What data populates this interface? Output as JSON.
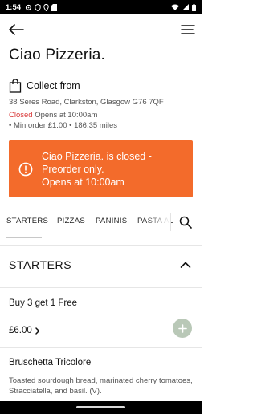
{
  "status_bar": {
    "time": "1:54",
    "icons": [
      "gear-icon",
      "shield-icon",
      "location-pin-icon",
      "sd-card-icon",
      "wifi-icon",
      "signal-icon",
      "battery-icon"
    ]
  },
  "header": {
    "back_icon": "arrow-left-icon",
    "menu_icon": "hamburger-menu-icon"
  },
  "restaurant": {
    "name": "Ciao Pizzeria.",
    "collect_label": "Collect from",
    "address": "38 Seres Road, Clarkston, Glasgow G76 7QF",
    "status_closed": "Closed",
    "opens_text": " Opens at 10:00am",
    "min_order": "• Min order £1.00 • 186.35  miles"
  },
  "banner": {
    "lines": [
      "Ciao Pizzeria. is closed -",
      "Preorder only.",
      "Opens at 10:00am"
    ],
    "color": "#f36b2b"
  },
  "category_tabs": {
    "items": [
      "STARTERS",
      "PIZZAS",
      "PANINIS",
      "PASTA AL"
    ],
    "active_index": 0
  },
  "section": {
    "title": "STARTERS"
  },
  "menu_items": [
    {
      "name": "Buy 3 get 1 Free",
      "price": "£6.00"
    },
    {
      "name": "Bruschetta Tricolore",
      "description": "Toasted sourdough bread, marinated cherry tomatoes, Stracciatella, and basil. (V)."
    }
  ],
  "colors": {
    "accent": "#f36b2b",
    "closed": "#d93b3b",
    "add_button": "#b9c8b7"
  }
}
